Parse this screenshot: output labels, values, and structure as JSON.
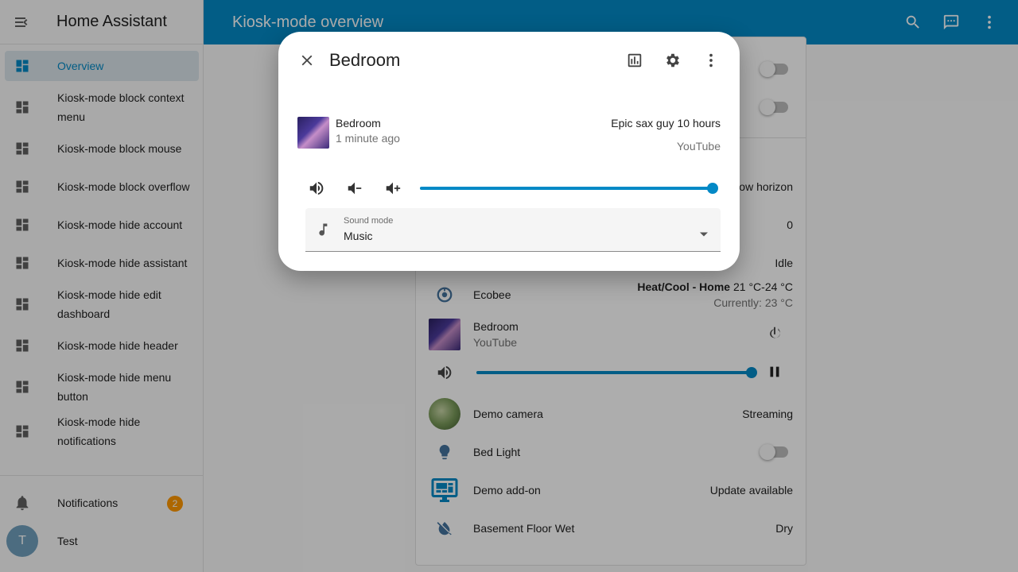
{
  "sidebar": {
    "title": "Home Assistant",
    "items": [
      {
        "label": "Overview",
        "active": true
      },
      {
        "label": "Kiosk-mode block context menu"
      },
      {
        "label": "Kiosk-mode block mouse"
      },
      {
        "label": "Kiosk-mode block overflow"
      },
      {
        "label": "Kiosk-mode hide account"
      },
      {
        "label": "Kiosk-mode hide assistant"
      },
      {
        "label": "Kiosk-mode hide edit dashboard"
      },
      {
        "label": "Kiosk-mode hide header"
      },
      {
        "label": "Kiosk-mode hide menu button"
      },
      {
        "label": "Kiosk-mode hide notifications"
      }
    ],
    "notifications": {
      "label": "Notifications",
      "count": "2"
    },
    "user": {
      "initial": "T",
      "name": "Test"
    }
  },
  "header": {
    "title": "Kiosk-mode overview"
  },
  "card": {
    "partial_status_1": "ow horizon",
    "partial_status_2": "0",
    "partial_status_3": "Idle",
    "ecobee": {
      "name": "Ecobee",
      "mode": "Heat/Cool - Home",
      "range": "21 °C-24 °C",
      "current": "Currently: 23 °C"
    },
    "media": {
      "name": "Bedroom",
      "source": "YouTube",
      "volume": 1.0
    },
    "camera": {
      "name": "Demo camera",
      "state": "Streaming"
    },
    "bed_light": {
      "name": "Bed Light"
    },
    "addon": {
      "name": "Demo add-on",
      "state": "Update available"
    },
    "basement": {
      "name": "Basement Floor Wet",
      "state": "Dry"
    }
  },
  "dialog": {
    "title": "Bedroom",
    "player_name": "Bedroom",
    "time_ago": "1 minute ago",
    "media_title": "Epic sax guy 10 hours",
    "media_source": "YouTube",
    "volume": 1.0,
    "sound_mode": {
      "label": "Sound mode",
      "value": "Music"
    }
  },
  "colors": {
    "primary": "#0389c6",
    "badge": "#ff9800"
  }
}
